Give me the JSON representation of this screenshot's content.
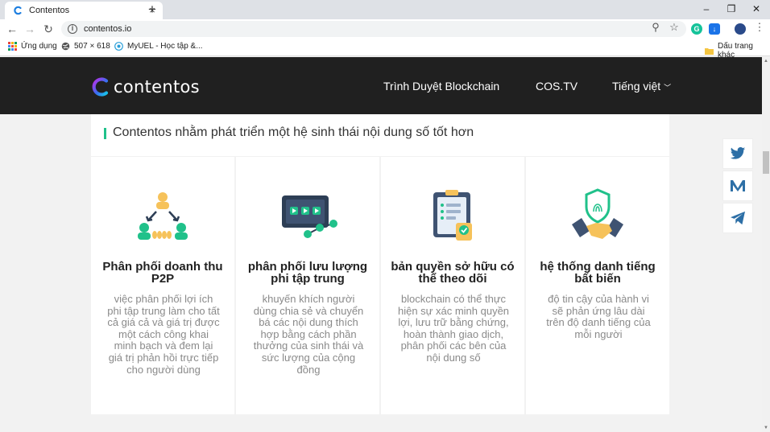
{
  "browser": {
    "tab_title": "Contentos",
    "url": "contentos.io",
    "bookmarks": [
      "Ứng dụng",
      "507 × 618",
      "MyUEL - Học tập &...",
      "Dấu trang khác"
    ]
  },
  "site": {
    "brand": "contentos",
    "nav": [
      "Trình Duyệt Blockchain",
      "COS.TV",
      "Tiếng việt"
    ],
    "banner": "Contentos nhằm phát triển một hệ sinh thái nội dung số tốt hơn",
    "accent_color": "#20c18a",
    "cards": [
      {
        "title": "Phân phối doanh thu P2P",
        "desc": "việc phân phối lợi ích phi tập trung làm cho tất cả giá cả và giá trị được một cách công khai minh bạch và đem lại giá trị phản hồi trực tiếp cho người dùng",
        "icon": "p2p-revenue-icon"
      },
      {
        "title": "phân phối lưu lượng phi tập trung",
        "desc": "khuyến khích người dùng chia sẻ và chuyển bá các nội dung thích hợp bằng cách phần thưởng của sinh thái và sức lượng của cộng đồng",
        "icon": "traffic-distribution-icon"
      },
      {
        "title": "bản quyền sở hữu có thể theo dõi",
        "desc": "blockchain có thể thực hiện sự xác minh quyền lợi, lưu trữ bằng chứng, hoàn thành giao dịch, phân phối các bên của nội dung số",
        "icon": "copyright-clipboard-icon"
      },
      {
        "title": "hệ thống danh tiếng bất biến",
        "desc": "độ tin cậy của hành vi sẽ phản ứng lâu dài trên độ danh tiếng của mỗi người",
        "icon": "reputation-handshake-icon"
      }
    ],
    "share": [
      "twitter-icon",
      "medium-icon",
      "telegram-icon"
    ]
  }
}
